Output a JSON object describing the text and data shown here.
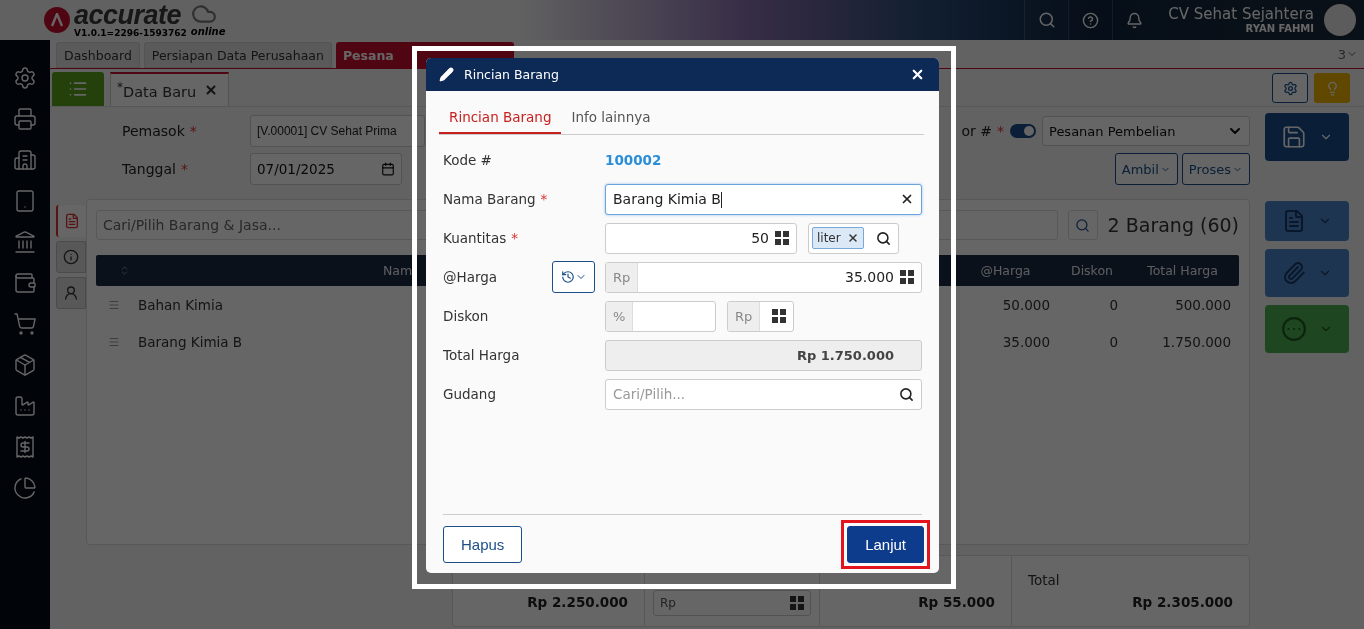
{
  "app": {
    "logo": "accurate",
    "logo_sub": "online",
    "version": "V1.0.1=2296-1593762",
    "company": "CV Sehat Sejahtera",
    "user": "RYAN FAHMI"
  },
  "page_tabs": [
    {
      "label": "Dashboard",
      "selected": false
    },
    {
      "label": "Persiapan Data Perusahaan",
      "selected": false
    },
    {
      "label": "Pesana",
      "selected": true
    }
  ],
  "tab_count": "3",
  "doc_tab": {
    "mark": "*",
    "label": "Data Baru"
  },
  "form": {
    "fields": [
      {
        "label": "Pemasok",
        "required": true,
        "value": "[V.00001] CV Sehat Prima"
      },
      {
        "label": "Tanggal",
        "required": true,
        "value": "07/01/2025"
      }
    ],
    "number": {
      "label": "or #",
      "required": true,
      "auto": true,
      "value": "Pesanan Pembelian"
    },
    "buttons": [
      "Ambil",
      "Proses"
    ]
  },
  "detail": {
    "search_placeholder": "Cari/Pilih Barang & Jasa...",
    "count": "2 Barang (60)",
    "columns": [
      "Nam",
      "@Harga",
      "Diskon",
      "Total Harga"
    ],
    "rows": [
      {
        "name": "Bahan Kimia",
        "price": "50.000",
        "discount": "0",
        "total": "500.000"
      },
      {
        "name": "Barang Kimia B",
        "price": "35.000",
        "discount": "0",
        "total": "1.750.000"
      }
    ]
  },
  "summary": {
    "subtotal": "Rp 2.250.000",
    "discount_prefix": "Rp",
    "tax": "Rp 55.000",
    "total_label": "Total",
    "total": "Rp 2.305.000"
  },
  "dialog": {
    "title": "Rincian Barang",
    "tabs": [
      {
        "label": "Rincian Barang",
        "selected": true
      },
      {
        "label": "Info lainnya",
        "selected": false
      }
    ],
    "rows": [
      {
        "kind": "text",
        "label": "Kode #",
        "required": false,
        "value": "100002"
      },
      {
        "kind": "input",
        "label": "Nama Barang",
        "required": true,
        "value": "Barang Kimia B",
        "focused": true
      },
      {
        "kind": "quantity",
        "label": "Kuantitas",
        "required": true,
        "value": "50",
        "unit": "liter"
      },
      {
        "kind": "price",
        "label": "@Harga",
        "required": false,
        "prefix": "Rp",
        "value": "35.000"
      },
      {
        "kind": "discount",
        "label": "Diskon",
        "required": false,
        "percent_prefix": "%",
        "amount_prefix": "Rp"
      },
      {
        "kind": "readonly",
        "label": "Total Harga",
        "required": false,
        "value": "Rp 1.750.000"
      },
      {
        "kind": "search",
        "label": "Gudang",
        "required": false,
        "placeholder": "Cari/Pilih..."
      }
    ],
    "buttons": [
      {
        "label": "Hapus",
        "kind": "secondary",
        "highlighted": false
      },
      {
        "label": "Lanjut",
        "kind": "primary",
        "highlighted": true
      }
    ]
  }
}
